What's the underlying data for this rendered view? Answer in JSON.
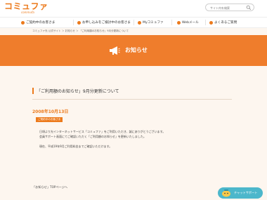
{
  "header": {
    "logo_main": "コミュファ",
    "logo_sub": "commufa",
    "search_placeholder": "サイト内を検索"
  },
  "nav": {
    "items": [
      {
        "label": "ご契約中のお客さま"
      },
      {
        "label": "お申し込みをご検討中のお客さま"
      },
      {
        "label": "Myコミュファ"
      },
      {
        "label": "Webメール"
      },
      {
        "label": "よくあるご質問"
      }
    ]
  },
  "breadcrumb": "コミュファ光 公式サイト ＞ お知らせ ＞ 「ご利用額のお知らせ」9月分更新について",
  "banner": {
    "title": "お知らせ"
  },
  "article": {
    "title": "「ご利用額のお知らせ」9月分更新について",
    "date": "2008年10月13日",
    "badge": "ご契約中のお客さま",
    "paragraphs": [
      "日頃より光インターネットサービス「コミュファ」をご利用いただき、誠にありがとうございます。",
      "会員サポート画面にてご確認いただく「ご利用額のお知らせ」を更新いたしました。",
      "現在、平成19年9月ご利用料金までご確認いただけます。"
    ]
  },
  "footer": {
    "back_link": "「お知らせ」TOPページへ"
  },
  "chat": {
    "label": "チャットサポート"
  },
  "colors": {
    "accent": "#ec7a1c",
    "banner": "#ef7d2c",
    "chat": "#4cb7cb"
  }
}
